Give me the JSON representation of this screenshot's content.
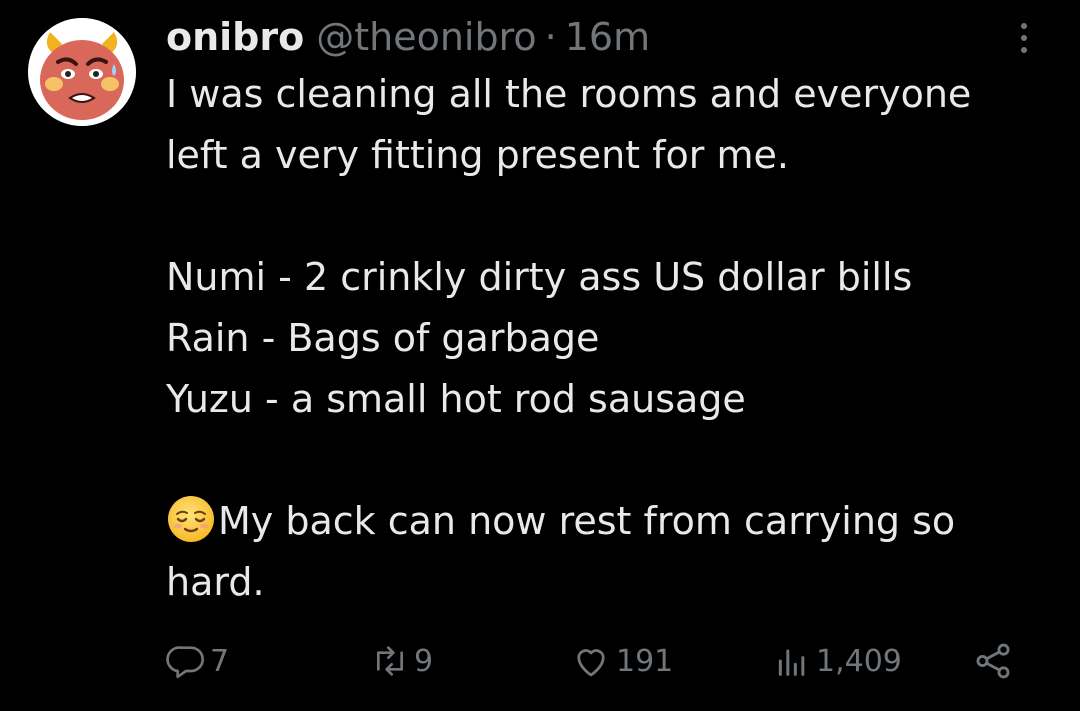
{
  "tweet": {
    "display_name": "onibro",
    "handle": "@theonibro",
    "separator": "·",
    "time": "16m",
    "lines": [
      "I was cleaning all the rooms and everyone",
      "left a very fitting present for me.",
      "",
      "Numi - 2 crinkly dirty ass US dollar bills",
      "Rain - Bags of garbage",
      "Yuzu - a small hot rod sausage",
      "",
      "My back can now rest from carrying so",
      "hard."
    ],
    "emoji": "relieved-face-emoji"
  },
  "actions": {
    "replies": "7",
    "reposts": "9",
    "likes": "191",
    "views": "1,409"
  },
  "icons": {
    "more": "more-options-icon",
    "reply": "reply-icon",
    "repost": "repost-icon",
    "like": "heart-icon",
    "views": "views-icon",
    "share": "share-icon"
  },
  "colors": {
    "background": "#000000",
    "text": "#e7e9ea",
    "secondary": "#71767b"
  }
}
